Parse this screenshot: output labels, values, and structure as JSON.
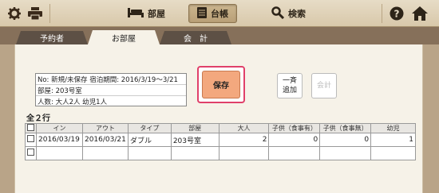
{
  "topbar": {
    "items": [
      {
        "label": "部屋"
      },
      {
        "label": "台帳"
      },
      {
        "label": "検索"
      }
    ]
  },
  "tabs": [
    "予約者",
    "お部屋",
    "会　計"
  ],
  "info": {
    "row1": "No: 新規/未保存 宿泊期間: 2016/3/19～3/21",
    "row2": "部屋: 203号室",
    "row3": "人数: 大人2人 幼児1人"
  },
  "buttons": {
    "save": "保存",
    "merge_line1": "一斉",
    "merge_line2": "追加",
    "account": "会計"
  },
  "count_label": "全２行",
  "table": {
    "headers": [
      "イン",
      "アウト",
      "タイプ",
      "部屋",
      "大人",
      "子供（食事有）",
      "子供（食事無）",
      "幼児"
    ],
    "rows": [
      {
        "in": "2016/03/19",
        "out": "2016/03/21",
        "type": "ダブル",
        "room": "203号室",
        "adult": "2",
        "child_meal": "0",
        "child_nomeal": "0",
        "infant": "1"
      }
    ]
  }
}
